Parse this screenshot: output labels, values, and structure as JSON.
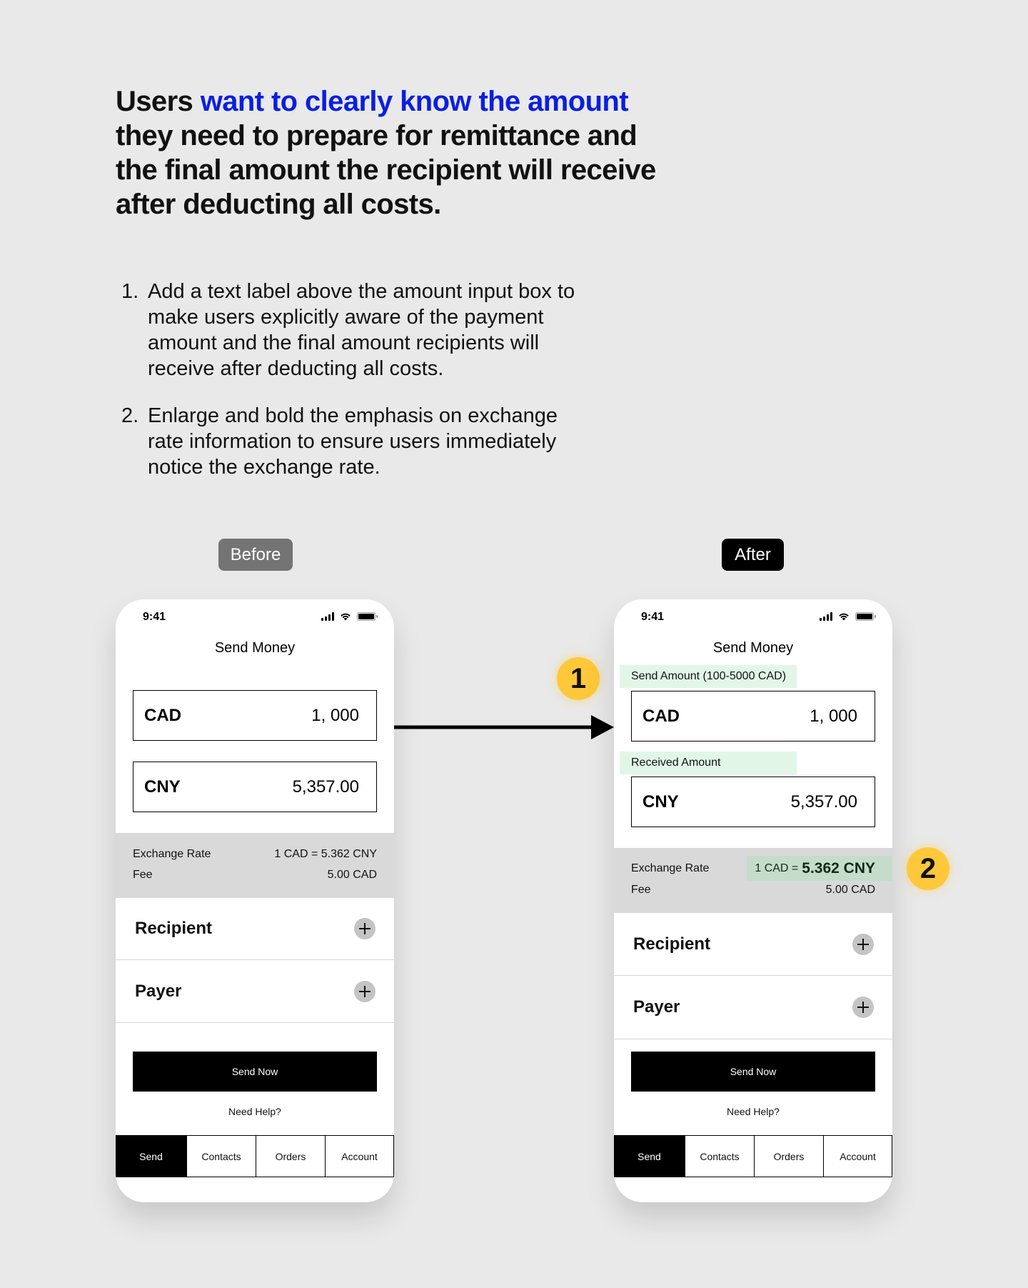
{
  "headline": {
    "prefix": "Users ",
    "highlight": "want to clearly know the amount",
    "suffix": " they need to prepare for remittance and the final amount the recipient will receive after deducting all costs.",
    "highlight_color": "#0a1fe0"
  },
  "points": [
    {
      "num": "1.",
      "text": "Add a text label above the amount input box to make users explicitly aware of the payment amount and the final amount recipients will receive after deducting all costs."
    },
    {
      "num": "2.",
      "text": "Enlarge and bold the emphasis on exchange rate information to ensure users immediately notice the exchange rate."
    }
  ],
  "labels": {
    "before": "Before",
    "after": "After"
  },
  "badges": {
    "one": "1",
    "two": "2",
    "color": "#fec83a"
  },
  "before_phone": {
    "time": "9:41",
    "title": "Send Money",
    "send": {
      "currency": "CAD",
      "value": "1, 000"
    },
    "receive": {
      "currency": "CNY",
      "value": "5,357.00"
    },
    "exchange_label": "Exchange Rate",
    "exchange_value": "1 CAD = 5.362 CNY",
    "fee_label": "Fee",
    "fee_value": "5.00 CAD",
    "recipient": "Recipient",
    "payer": "Payer",
    "send_button": "Send Now",
    "help": "Need Help?",
    "tabs": [
      "Send",
      "Contacts",
      "Orders",
      "Account"
    ]
  },
  "after_phone": {
    "time": "9:41",
    "title": "Send Money",
    "send_label": "Send Amount (100-5000 CAD)",
    "send": {
      "currency": "CAD",
      "value": "1, 000"
    },
    "receive_label": "Received Amount",
    "receive": {
      "currency": "CNY",
      "value": "5,357.00"
    },
    "exchange_label": "Exchange Rate",
    "exchange_prefix": "1 CAD =",
    "exchange_emphasis": "5.362 CNY",
    "fee_label": "Fee",
    "fee_value": "5.00 CAD",
    "recipient": "Recipient",
    "payer": "Payer",
    "send_button": "Send Now",
    "help": "Need Help?",
    "tabs": [
      "Send",
      "Contacts",
      "Orders",
      "Account"
    ]
  }
}
